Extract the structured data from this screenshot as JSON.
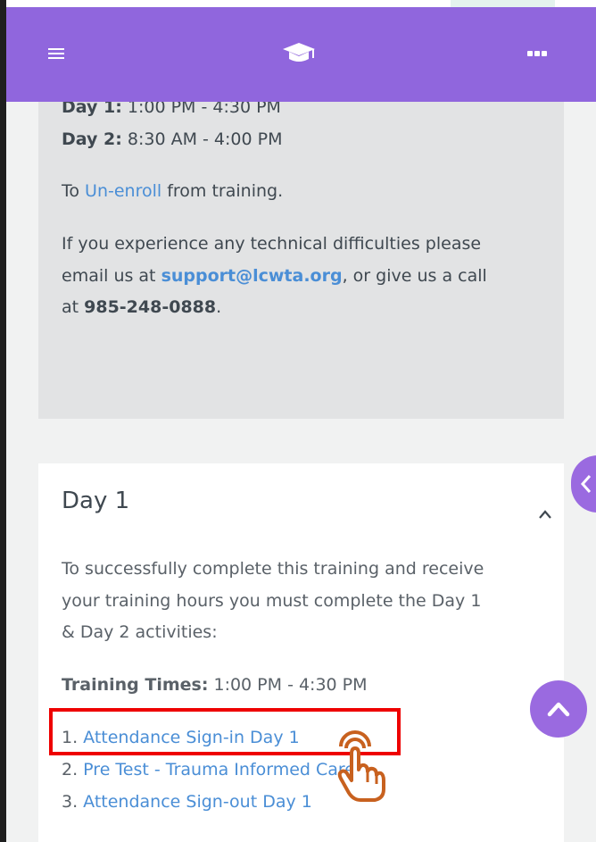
{
  "header": {
    "menu_icon": "hamburger-menu-icon",
    "logo_icon": "graduation-cap-icon",
    "more_label": "···"
  },
  "info": {
    "day1_label": "Day 1:",
    "day1_time": " 1:00 PM - 4:30 PM",
    "day2_label": "Day 2:",
    "day2_time": " 8:30 AM - 4:00 PM",
    "unenroll_prefix": "To ",
    "unenroll_link": "Un-enroll",
    "unenroll_suffix": " from training.",
    "support_line1": "If you experience any technical difficulties please",
    "support_line2_prefix": "email us at ",
    "support_email": "support@lcwta.org",
    "support_line2_suffix": ", or give us a call",
    "support_line3_prefix": "at ",
    "support_phone": "985-248-0888",
    "support_line3_suffix": "."
  },
  "day_section": {
    "title": "Day 1",
    "desc_line1": "To successfully complete this training and receive",
    "desc_line2": "your training hours you must complete the Day 1",
    "desc_line3": "& Day 2 activities:",
    "times_label": "Training Times:",
    "times_value": " 1:00 PM - 4:30 PM",
    "activities": [
      {
        "num": "1. ",
        "label": "Attendance Sign-in Day 1"
      },
      {
        "num": "2. ",
        "label": "Pre Test - Trauma Informed Care"
      },
      {
        "num": "3. ",
        "label": "Attendance Sign-out Day 1"
      }
    ]
  },
  "colors": {
    "header_bg": "#9066dd",
    "link": "#4a8ed6",
    "highlight": "#ee0000",
    "fab": "#9a6ae0"
  }
}
